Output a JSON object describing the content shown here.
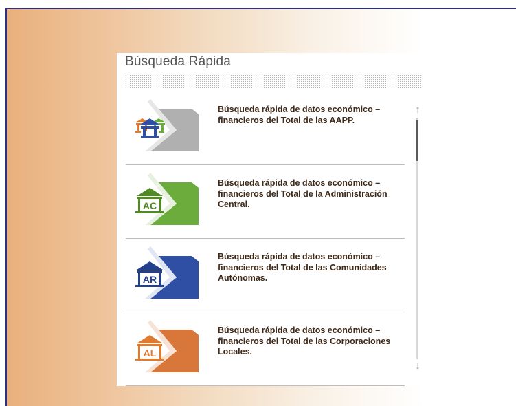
{
  "panel": {
    "title": "Búsqueda Rápida"
  },
  "items": [
    {
      "label": "Búsqueda rápida de datos económico – financieros del Total de las AAPP.",
      "badge": "",
      "color": "#a8a8a8",
      "icon": "aapp-buildings-icon"
    },
    {
      "label": "Búsqueda rápida de datos económico – financieros del Total de la Administración Central.",
      "badge": "AC",
      "color": "#6cac3c",
      "icon": "ac-building-icon"
    },
    {
      "label": "Búsqueda rápida de datos económico – financieros del Total de las Comunidades Autónomas.",
      "badge": "AR",
      "color": "#2f4fa4",
      "icon": "ar-building-icon"
    },
    {
      "label": "Búsqueda rápida de datos económico – financieros del Total de las Corporaciones Locales.",
      "badge": "AL",
      "color": "#d9773a",
      "icon": "al-building-icon"
    }
  ],
  "scrollbar": {
    "up_icon": "arrow-up-icon",
    "down_icon": "arrow-down-icon",
    "up_glyph": "↑",
    "down_glyph": "↓"
  }
}
